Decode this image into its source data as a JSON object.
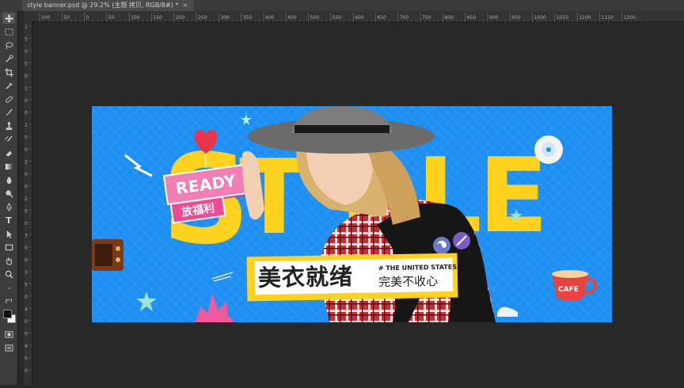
{
  "document_tab": {
    "title": "style banner.psd @ 29.2% (主题 拷贝, RGB/8#) *",
    "close_glyph": "×"
  },
  "ruler": {
    "top_ticks": [
      "100",
      "50",
      "0",
      "50",
      "100",
      "150",
      "200",
      "250",
      "300",
      "350",
      "400",
      "450",
      "500",
      "550",
      "600",
      "650",
      "700",
      "750",
      "800",
      "850",
      "900",
      "950",
      "1000",
      "1050",
      "1100",
      "1150",
      "1200"
    ],
    "left_ticks": [
      "1",
      "5",
      "0",
      "5",
      "0",
      "1",
      "0",
      "0",
      "1",
      "5",
      "0",
      "2",
      "0",
      "0",
      "2",
      "5",
      "0",
      "3",
      "0",
      "0",
      "3",
      "5",
      "0",
      "4",
      "0",
      "0",
      "4",
      "5",
      "0"
    ]
  },
  "toolbar": {
    "tools": [
      "move-tool",
      "marquee-tool",
      "lasso-tool",
      "quick-select-tool",
      "crop-tool",
      "eyedropper-tool",
      "healing-tool",
      "brush-tool",
      "stamp-tool",
      "history-brush-tool",
      "eraser-tool",
      "gradient-tool",
      "blur-tool",
      "dodge-tool",
      "pen-tool",
      "type-tool",
      "path-select-tool",
      "shape-tool",
      "hand-tool",
      "zoom-tool",
      "more-tools",
      "swap-colors",
      "foreground-background-colors",
      "quick-mask",
      "screen-mode"
    ],
    "type_glyph": "T",
    "more_glyph": "···",
    "foreground_color": "#111111",
    "background_color": "#ffffff"
  },
  "banner": {
    "background_color": "#1d8ef2",
    "accent_yellow": "#ffd21f",
    "headline_letters": [
      "S",
      "T",
      "Y",
      "L",
      "E"
    ],
    "ready_text": "READY",
    "promo_text": "放福利",
    "slogan_main": "美衣就绪",
    "slogan_tag": "# THE UNITED STATES",
    "slogan_sub": "完美不收心",
    "cup_label": "CAFE",
    "sticker_colors": {
      "ready": "#f27fb4",
      "promo": "#f04a93"
    }
  }
}
